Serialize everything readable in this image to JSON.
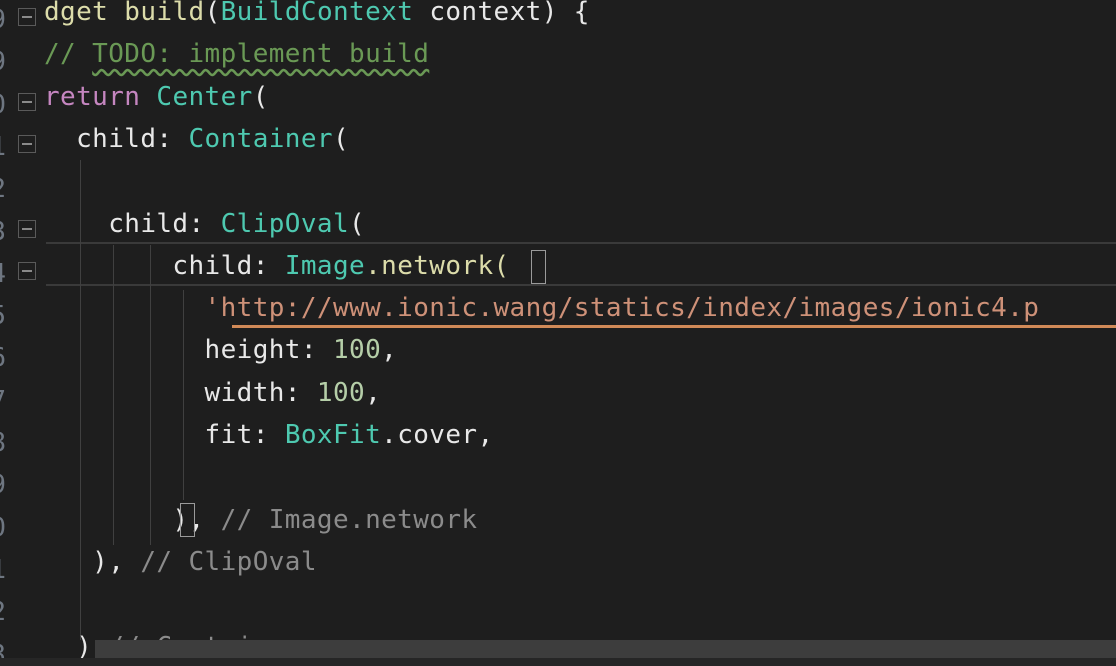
{
  "editor": {
    "lines": [
      {
        "num": "9",
        "fold": true,
        "tokens": [
          {
            "t": "dget ",
            "c": "fn"
          },
          {
            "t": "build",
            "c": "fn"
          },
          {
            "t": "(",
            "c": "pl"
          },
          {
            "t": "BuildContext",
            "c": "ty"
          },
          {
            "t": " context) {",
            "c": "pl"
          }
        ]
      },
      {
        "num": "9",
        "fold": false,
        "tokens": [
          {
            "t": "// ",
            "c": "cm"
          },
          {
            "t": "TODO: implement build",
            "c": "cm squiggle"
          }
        ]
      },
      {
        "num": "0",
        "fold": true,
        "tokens": [
          {
            "t": "return",
            "c": "kw"
          },
          {
            "t": " ",
            "c": "pl"
          },
          {
            "t": "Center",
            "c": "ty"
          },
          {
            "t": "(",
            "c": "pl"
          }
        ]
      },
      {
        "num": "1",
        "fold": true,
        "tokens": [
          {
            "t": "  child: ",
            "c": "pl"
          },
          {
            "t": "Container",
            "c": "ty"
          },
          {
            "t": "(",
            "c": "pl"
          }
        ]
      },
      {
        "num": "2",
        "fold": false,
        "tokens": []
      },
      {
        "num": "3",
        "fold": true,
        "tokens": [
          {
            "t": "    child: ",
            "c": "pl"
          },
          {
            "t": "ClipOval",
            "c": "ty"
          },
          {
            "t": "(",
            "c": "pl"
          }
        ]
      },
      {
        "num": "4",
        "fold": true,
        "tokens": [
          {
            "t": "        child: ",
            "c": "pl"
          },
          {
            "t": "Image",
            "c": "ty"
          },
          {
            "t": ".network(",
            "c": "fn"
          }
        ]
      },
      {
        "num": "5",
        "fold": false,
        "tokens": [
          {
            "t": "          'http://www.ionic.wang/statics/index/images/ionic4.p",
            "c": "st"
          }
        ]
      },
      {
        "num": "6",
        "fold": false,
        "tokens": [
          {
            "t": "          height: ",
            "c": "pl"
          },
          {
            "t": "100",
            "c": "nu"
          },
          {
            "t": ",",
            "c": "pl"
          }
        ]
      },
      {
        "num": "7",
        "fold": false,
        "tokens": [
          {
            "t": "          width: ",
            "c": "pl"
          },
          {
            "t": "100",
            "c": "nu"
          },
          {
            "t": ",",
            "c": "pl"
          }
        ]
      },
      {
        "num": "8",
        "fold": false,
        "tokens": [
          {
            "t": "          fit: ",
            "c": "pl"
          },
          {
            "t": "BoxFit",
            "c": "ty"
          },
          {
            "t": ".cover,",
            "c": "pl"
          }
        ]
      },
      {
        "num": "9",
        "fold": false,
        "tokens": []
      },
      {
        "num": "0",
        "fold": false,
        "tokens": [
          {
            "t": "        ), ",
            "c": "pl"
          },
          {
            "t": "// Image.network",
            "c": "cm2"
          }
        ]
      },
      {
        "num": "1",
        "fold": false,
        "tokens": [
          {
            "t": "   ), ",
            "c": "pl"
          },
          {
            "t": "// ClipOval",
            "c": "cm2"
          }
        ]
      },
      {
        "num": "2",
        "fold": false,
        "tokens": []
      },
      {
        "num": "3",
        "fold": false,
        "tokens": [
          {
            "t": "  ) ",
            "c": "pl"
          },
          {
            "t": "// Container",
            "c": "cm2"
          }
        ]
      }
    ]
  },
  "colors": {
    "background": "#1e1e1e",
    "keyword": "#c586c0",
    "type": "#4ec9b0",
    "function": "#dcdcaa",
    "comment": "#6a9955",
    "number": "#b5cea8",
    "string": "#ce9178"
  }
}
